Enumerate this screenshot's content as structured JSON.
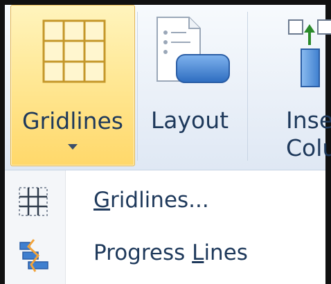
{
  "ribbon": {
    "gridlines": {
      "label": "Gridlines",
      "icon": "table-grid-icon",
      "state": "pressed",
      "accent": "#ffd86a"
    },
    "layout": {
      "label": "Layout",
      "icon": "layout-document-icon"
    },
    "insert_column": {
      "label_line1": "Inse",
      "label_line2": "Colu",
      "icon": "insert-column-icon"
    }
  },
  "menu": {
    "items": [
      {
        "label_mnemonic": "G",
        "label_rest": "ridlines...",
        "icon": "gridlines-dotted-icon"
      },
      {
        "label_before": "Progress ",
        "label_mnemonic": "L",
        "label_rest": "ines",
        "icon": "progress-lines-icon"
      }
    ]
  },
  "colors": {
    "text": "#1e395b",
    "ribbon_bg": "#e6eef8",
    "highlight": "#ffe896",
    "icon_blue": "#3f7fcf",
    "progress_orange": "#f2a33a"
  }
}
